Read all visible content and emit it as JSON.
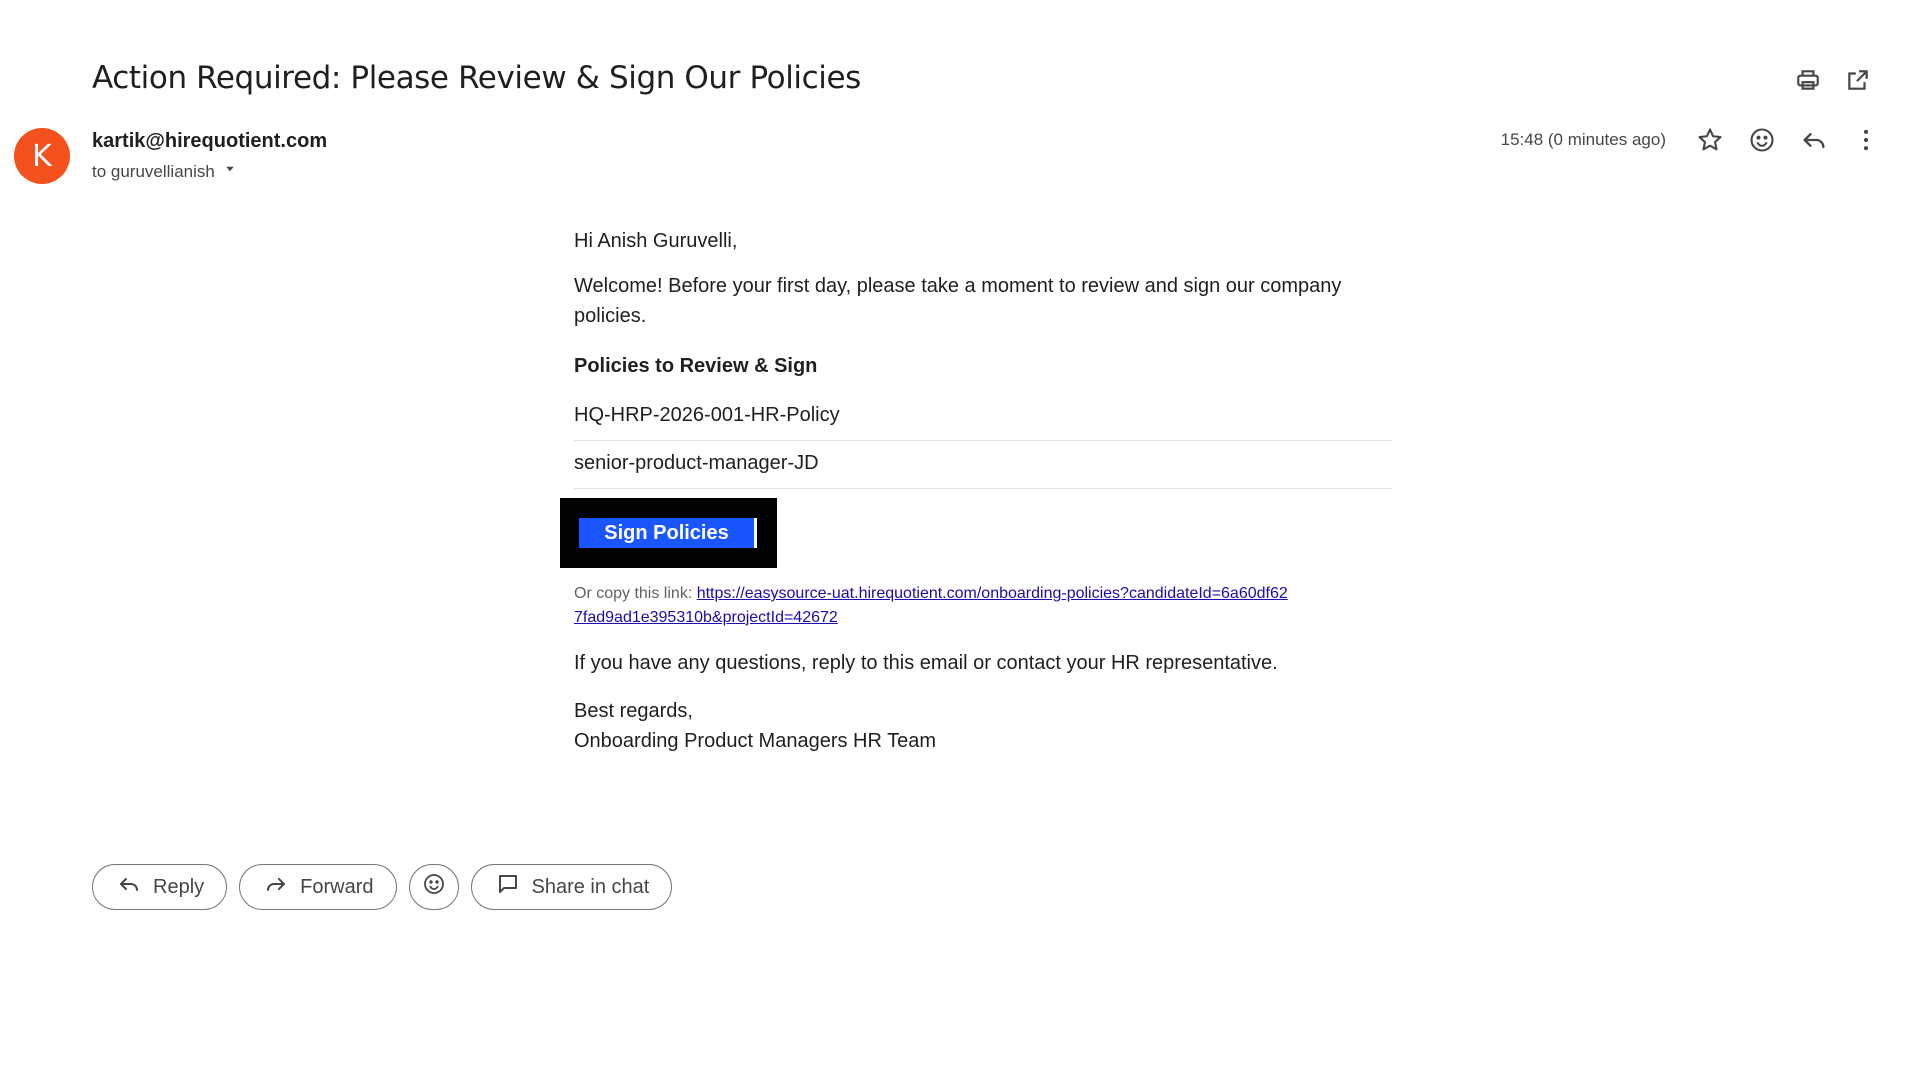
{
  "email": {
    "subject": "Action Required: Please Review & Sign Our Policies",
    "avatar_letter": "K",
    "sender": "kartik@hirequotient.com",
    "recipient": "to guruvellianish",
    "timestamp": "15:48 (0 minutes ago)"
  },
  "body": {
    "greeting": "Hi Anish Guruvelli,",
    "intro": "Welcome! Before your first day, please take a moment to review and sign our company policies.",
    "policies_heading": "Policies to Review & Sign",
    "policies": [
      "HQ-HRP-2026-001-HR-Policy",
      "senior-product-manager-JD"
    ],
    "sign_button": "Sign Policies",
    "copy_prefix": "Or copy this link: ",
    "copy_link": "https://easysource-uat.hirequotient.com/onboarding-policies?candidateId=6a60df627fad9ad1e395310b&projectId=42672",
    "questions": "If you have any questions, reply to this email or contact your HR representative.",
    "regards": "Best regards,",
    "signature": "Onboarding Product Managers HR Team"
  },
  "actions": {
    "reply": "Reply",
    "forward": "Forward",
    "share": "Share in chat"
  },
  "icons": {
    "print": "print-icon",
    "open_new": "open-in-new-window-icon",
    "star": "star-icon",
    "emoji": "emoji-icon",
    "reply": "reply-icon",
    "more": "more-vertical-icon",
    "forward": "forward-icon",
    "chat": "chat-bubble-icon",
    "dropdown": "chevron-down-icon"
  },
  "colors": {
    "avatar": "#f4511e",
    "sign_button": "#1a56ff",
    "link": "#1a0dab"
  }
}
